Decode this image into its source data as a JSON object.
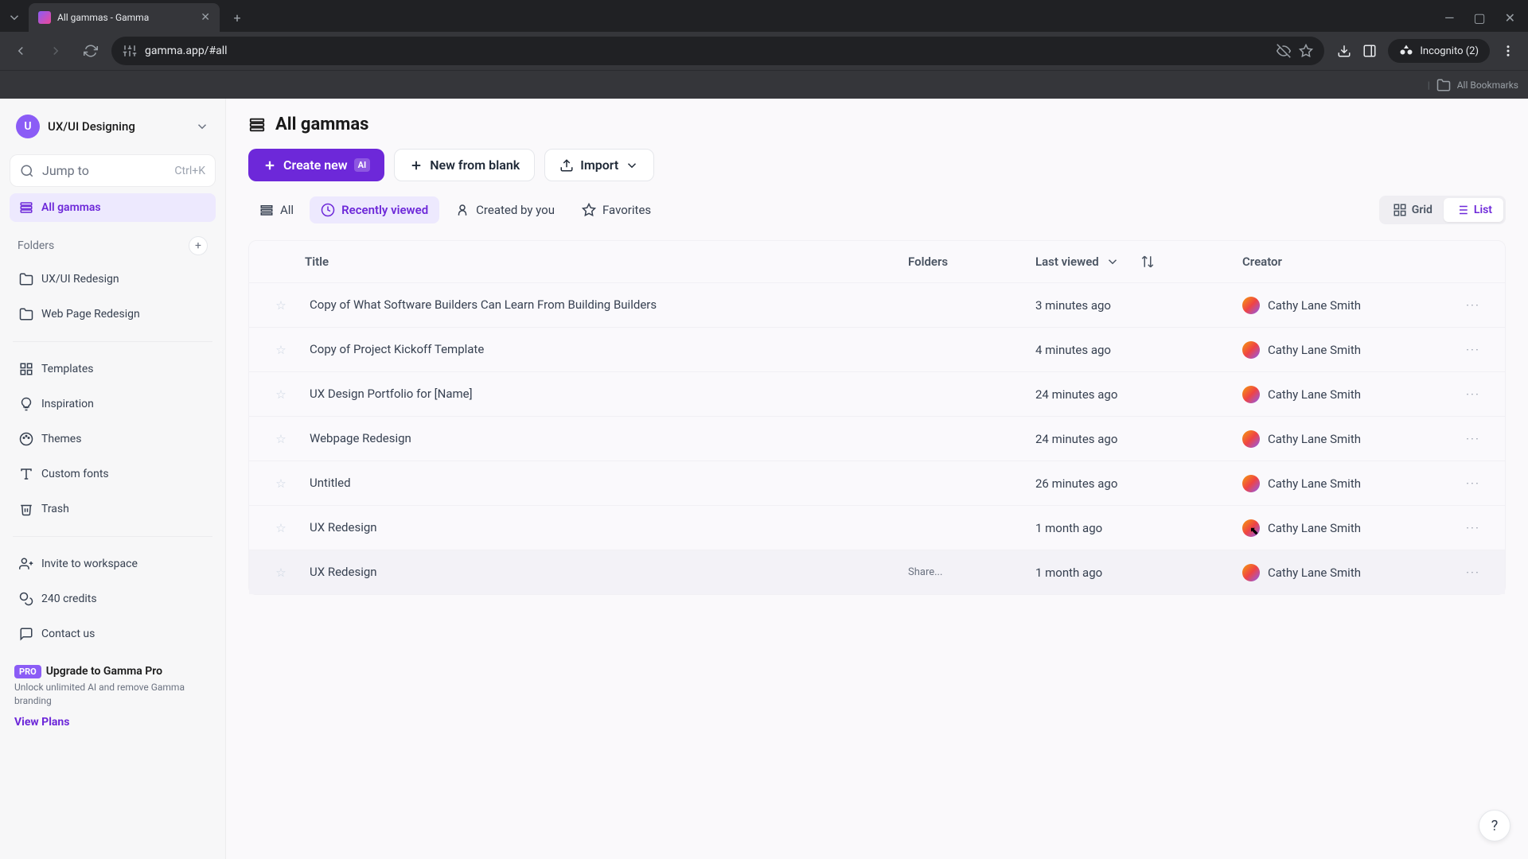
{
  "browser": {
    "tab_title": "All gammas - Gamma",
    "url": "gamma.app/#all",
    "incognito_label": "Incognito (2)",
    "bookmarks_label": "All Bookmarks"
  },
  "sidebar": {
    "workspace_initial": "U",
    "workspace_name": "UX/UI Designing",
    "search_placeholder": "Jump to",
    "search_shortcut": "Ctrl+K",
    "all_gammas": "All gammas",
    "folders_label": "Folders",
    "folders": [
      {
        "label": "UX/UI Redesign"
      },
      {
        "label": "Web Page Redesign"
      }
    ],
    "links": [
      {
        "label": "Templates",
        "icon": "templates"
      },
      {
        "label": "Inspiration",
        "icon": "inspiration"
      },
      {
        "label": "Themes",
        "icon": "themes"
      },
      {
        "label": "Custom fonts",
        "icon": "fonts"
      },
      {
        "label": "Trash",
        "icon": "trash"
      }
    ],
    "invite": "Invite to workspace",
    "credits": "240 credits",
    "contact": "Contact us",
    "pro_badge": "PRO",
    "pro_title": "Upgrade to Gamma Pro",
    "pro_sub": "Unlock unlimited AI and remove Gamma branding",
    "pro_link": "View Plans"
  },
  "header": {
    "title": "All gammas",
    "create_new": "Create new",
    "ai_badge": "AI",
    "new_blank": "New from blank",
    "import": "Import"
  },
  "filters": {
    "all": "All",
    "recent": "Recently viewed",
    "created": "Created by you",
    "favorites": "Favorites",
    "grid": "Grid",
    "list": "List"
  },
  "table": {
    "col_title": "Title",
    "col_folders": "Folders",
    "col_lastviewed": "Last viewed",
    "col_creator": "Creator",
    "share_label": "Share...",
    "rows": [
      {
        "title": "Copy of What Software Builders Can Learn From Building Builders",
        "last": "3 minutes ago",
        "creator": "Cathy Lane Smith"
      },
      {
        "title": "Copy of Project Kickoff Template",
        "last": "4 minutes ago",
        "creator": "Cathy Lane Smith"
      },
      {
        "title": "UX Design Portfolio for [Name]",
        "last": "24 minutes ago",
        "creator": "Cathy Lane Smith"
      },
      {
        "title": "Webpage Redesign",
        "last": "24 minutes ago",
        "creator": "Cathy Lane Smith"
      },
      {
        "title": "Untitled",
        "last": "26 minutes ago",
        "creator": "Cathy Lane Smith"
      },
      {
        "title": "UX Redesign",
        "last": "1 month ago",
        "creator": "Cathy Lane Smith"
      },
      {
        "title": "UX Redesign",
        "last": "1 month ago",
        "creator": "Cathy Lane Smith"
      }
    ]
  }
}
